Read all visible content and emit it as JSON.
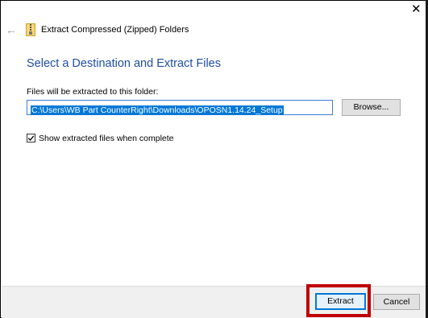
{
  "window": {
    "title": "Extract Compressed (Zipped) Folders",
    "close_glyph": "✕",
    "back_glyph": "←",
    "icon": "zip-folder-icon"
  },
  "main": {
    "heading": "Select a Destination and Extract Files",
    "folder_label": "Files will be extracted to this folder:",
    "path_value": "C:\\Users\\WB Part CounterRight\\Downloads\\OPOSN1.14.24_Setup",
    "browse_label": "Browse...",
    "show_files_label": "Show extracted files when complete",
    "show_files_checked": true
  },
  "footer": {
    "extract_label": "Extract",
    "cancel_label": "Cancel"
  },
  "colors": {
    "heading": "#1f4ea3",
    "selection": "#0078d7",
    "highlight": "#c00000"
  }
}
